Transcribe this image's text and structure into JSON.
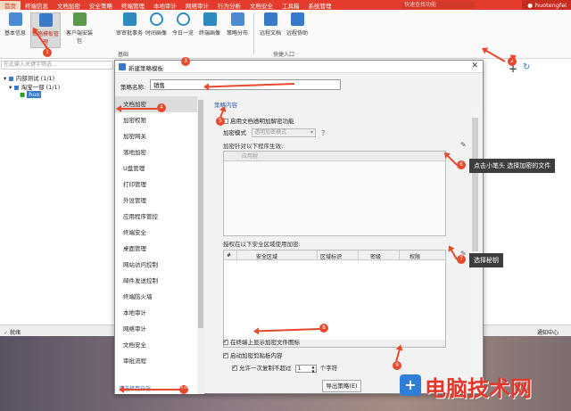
{
  "menubar": {
    "items": [
      "首页",
      "终端信息",
      "文档加密",
      "安全策略",
      "终端管理",
      "本地审计",
      "网络审计",
      "行为分析",
      "文档安全",
      "工具箱",
      "系统管理"
    ],
    "active_index": 0,
    "search_placeholder": "快速查找功能",
    "user": "huotengfei"
  },
  "ribbon": {
    "buttons": [
      "基本信息",
      "策略模板管理",
      "客户端安装包",
      "审审批事务",
      "时间画像",
      "今日一览",
      "终端画像",
      "策略分布",
      "远程文档",
      "远程协助"
    ],
    "groups": [
      "基础",
      "快捷入口"
    ]
  },
  "leftpane": {
    "search_placeholder": "在此输入关键字筛选...",
    "tree": [
      {
        "label": "内部测试 (1/1)"
      },
      {
        "label": "淘宝一部 (1/1)"
      },
      {
        "label": "huo"
      }
    ]
  },
  "statusbar": {
    "ready": "就绪",
    "notify": "通知中心"
  },
  "dialog": {
    "title": "新建策略模板",
    "name_label": "策略名称:",
    "name_value": "销售",
    "nav": [
      "文档加密",
      "加密权限",
      "加密网关",
      "落地加密",
      "U盘管理",
      "打印管理",
      "外设管理",
      "应用程序管控",
      "终端安全",
      "桌面管理",
      "网站访问控制",
      "邮件发送控制",
      "终端防火墙",
      "本地审计",
      "网络审计",
      "文档安全",
      "审批流程"
    ],
    "nav_selected": 0,
    "select_users_link": "请选择用户端",
    "section_title": "策略内容",
    "enable_label": "启用文档透明加解密功能",
    "mode_label": "加密模式",
    "mode_value": "透明加密模式",
    "enc_desc": "加密针对以下程序生效:",
    "enc_header": "应用程",
    "auth_desc": "授权在以下安全区域使用加密:",
    "auth_columns": [
      "#",
      "安全区域",
      "区域标识",
      "密级",
      "权限"
    ],
    "opt1_label": "在终端上显示加密文件图标",
    "opt2_label": "启动加密剪贴板内容",
    "opt3_prefix": "允许一次复制不超过",
    "opt3_value": "1",
    "opt3_suffix": "个字符",
    "export_label": "导出策略(E)"
  },
  "annotations": {
    "numbers": [
      "1",
      "2",
      "3",
      "4",
      "5",
      "6",
      "7",
      "8",
      "9",
      "10"
    ],
    "tip6": "点击小笔头 选择加密的文件",
    "tip7": "选择秘钥"
  },
  "watermark": {
    "text": "电脑技术网"
  },
  "colors": {
    "accent": "#e43c2c",
    "annotation": "#e6492c",
    "link": "#2d5fb0"
  }
}
